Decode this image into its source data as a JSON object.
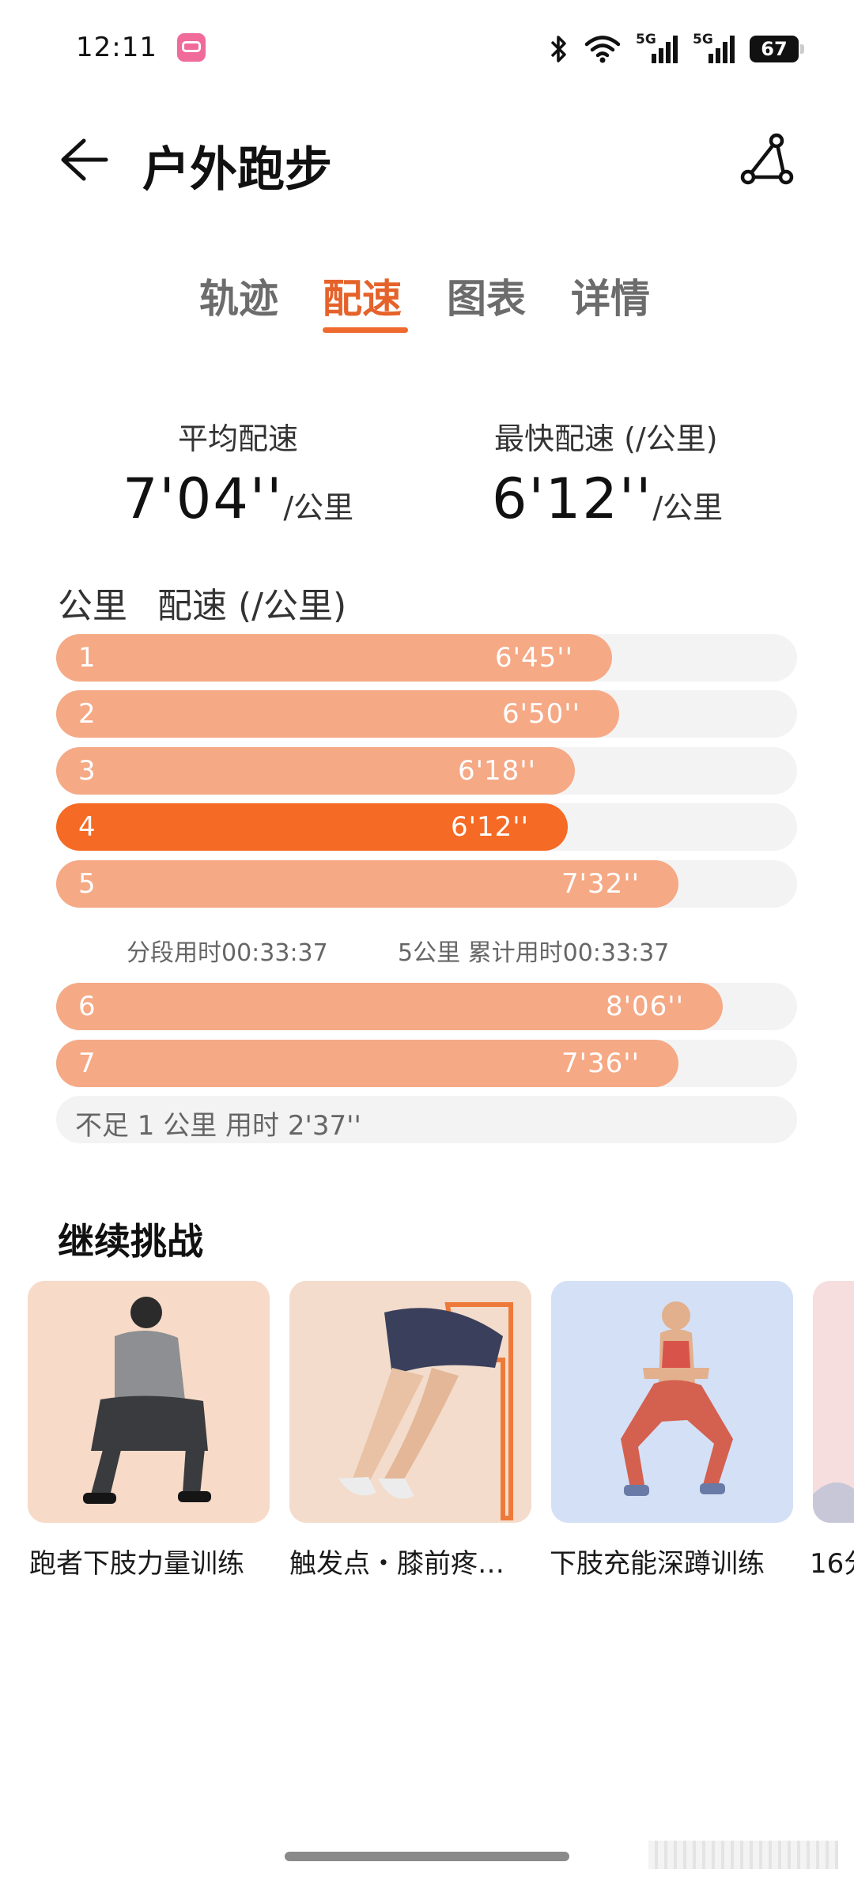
{
  "status_bar": {
    "time": "12:11",
    "network_1": "5G",
    "network_2": "5G",
    "battery": "67",
    "icons": [
      "bilibili-app-icon",
      "bluetooth-icon",
      "wifi-icon",
      "signal-icon",
      "battery-icon"
    ]
  },
  "header": {
    "title": "户外跑步",
    "back_icon": "back-arrow-icon",
    "route_icon": "route-share-icon"
  },
  "tabs": [
    {
      "label": "轨迹",
      "active": false
    },
    {
      "label": "配速",
      "active": true
    },
    {
      "label": "图表",
      "active": false
    },
    {
      "label": "详情",
      "active": false
    }
  ],
  "summary": {
    "avg_label": "平均配速",
    "avg_value": "7'04''",
    "avg_unit": "/公里",
    "fast_label": "最快配速 (/公里)",
    "fast_value": "6'12''",
    "fast_unit": "/公里"
  },
  "pace_list": {
    "col_km": "公里",
    "col_pace": "配速 (/公里)",
    "rows": [
      {
        "km": "1",
        "pace": "6'45''",
        "fill": 0.75,
        "fastest": false
      },
      {
        "km": "2",
        "pace": "6'50''",
        "fill": 0.76,
        "fastest": false
      },
      {
        "km": "3",
        "pace": "6'18''",
        "fill": 0.7,
        "fastest": false
      },
      {
        "km": "4",
        "pace": "6'12''",
        "fill": 0.69,
        "fastest": true
      },
      {
        "km": "5",
        "pace": "7'32''",
        "fill": 0.84,
        "fastest": false
      },
      {
        "km": "6",
        "pace": "8'06''",
        "fill": 0.9,
        "fastest": false
      },
      {
        "km": "7",
        "pace": "7'36''",
        "fill": 0.84,
        "fastest": false
      }
    ],
    "split_time": "分段用时00:33:37",
    "cumulative_time": "5公里 累计用时00:33:37",
    "remainder": "不足 1 公里 用时 2'37''"
  },
  "challenge": {
    "title": "继续挑战",
    "cards": [
      {
        "caption": "跑者下肢力量训练",
        "bg": "#f7dac8"
      },
      {
        "caption": "触发点・膝前疼…",
        "bg": "#f3dccb"
      },
      {
        "caption": "下肢充能深蹲训练",
        "bg": "#d4e0f6"
      },
      {
        "caption": "16分",
        "bg": "#f6dede"
      }
    ]
  },
  "colors": {
    "accent": "#e5622a",
    "bar": "#f5a985",
    "bar_fastest": "#f56a24",
    "track": "#f3f3f3"
  }
}
